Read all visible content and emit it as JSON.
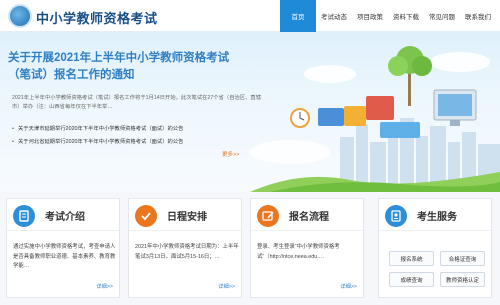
{
  "header": {
    "site_title": "中小学教师资格考试",
    "nav": [
      "首页",
      "考试动态",
      "项目政策",
      "资料下载",
      "常见问题",
      "联系我们"
    ]
  },
  "banner": {
    "title": "关于开展2021年上半年中小学教师资格考试（笔试）报名工作的通知",
    "body": "2021年上半年中小学教师资格考试（笔试）报名工作将于1月14日开始，此次笔试在27个省（自治区、直辖市）举办（注：山西省每年仅在下半年举…",
    "news": [
      "关于天津市延期举行2020年下半年中小学教师资格考试（面试）的公告",
      "关于河北省延期举行2020年下半年中小学教师资格考试（面试）的公告"
    ],
    "more": "更多>>"
  },
  "cards": [
    {
      "icon": "document-icon",
      "title": "考试介绍",
      "text": "通过实施中小学教师资格考试，考查申请人是否具备教师职业道德、基本素养、教育教学能…",
      "more": "详细>>",
      "color": "#2e8fd9"
    },
    {
      "icon": "checkmark-icon",
      "title": "日程安排",
      "text": "2021年中小学教师资格考试日期为：上半年笔试3月13日，面试5月15-16日；…",
      "more": "详细>>",
      "color": "#e8771f"
    },
    {
      "icon": "pencil-icon",
      "title": "报名流程",
      "text": "登录、考生登录“中小学教师资格考试”（http://ntce.neea.edu.…",
      "more": "详细>>",
      "color": "#e8771f"
    },
    {
      "icon": "badge-icon",
      "title": "考生服务",
      "buttons": [
        "报名系统",
        "合格证查询",
        "成绩查询",
        "教师资格认定"
      ],
      "color": "#2e8fd9"
    }
  ]
}
